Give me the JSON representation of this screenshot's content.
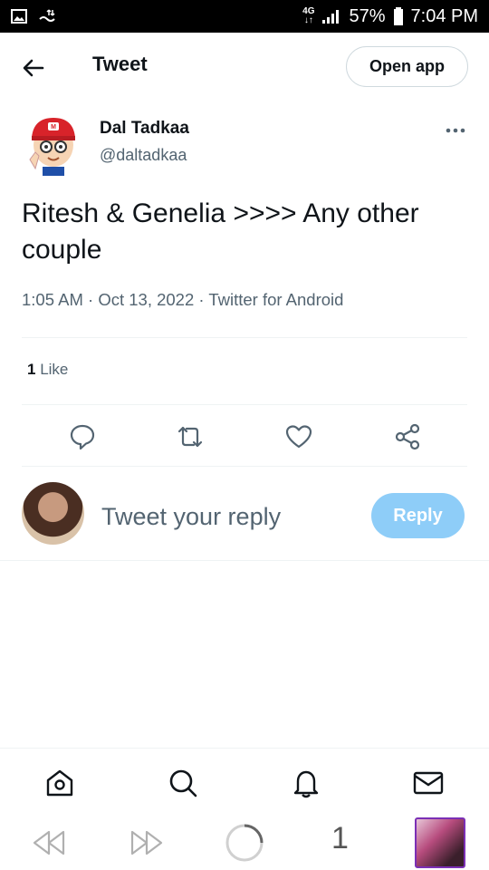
{
  "status_bar": {
    "network": "4G",
    "battery_percent": "57%",
    "time": "7:04 PM"
  },
  "header": {
    "title": "Tweet",
    "open_app_label": "Open app"
  },
  "tweet": {
    "author_name": "Dal Tadkaa",
    "author_handle": "@daltadkaa",
    "text": "Ritesh & Genelia >>>> Any other couple",
    "meta": "1:05 AM · Oct 13, 2022 · Twitter for Android",
    "like_count": "1",
    "like_label": "Like"
  },
  "reply": {
    "placeholder": "Tweet your reply",
    "button_label": "Reply"
  },
  "browser": {
    "tab_count": "1"
  },
  "icons": {
    "back": "arrow-left-icon",
    "more": "more-horizontal-icon",
    "reply": "comment-icon",
    "retweet": "retweet-icon",
    "like": "heart-icon",
    "share": "share-icon",
    "home": "home-icon",
    "search": "search-icon",
    "notifications": "bell-icon",
    "messages": "mail-icon"
  },
  "colors": {
    "reply_button": "#8ecdf8",
    "secondary_text": "#536471",
    "primary_text": "#0f1419"
  }
}
